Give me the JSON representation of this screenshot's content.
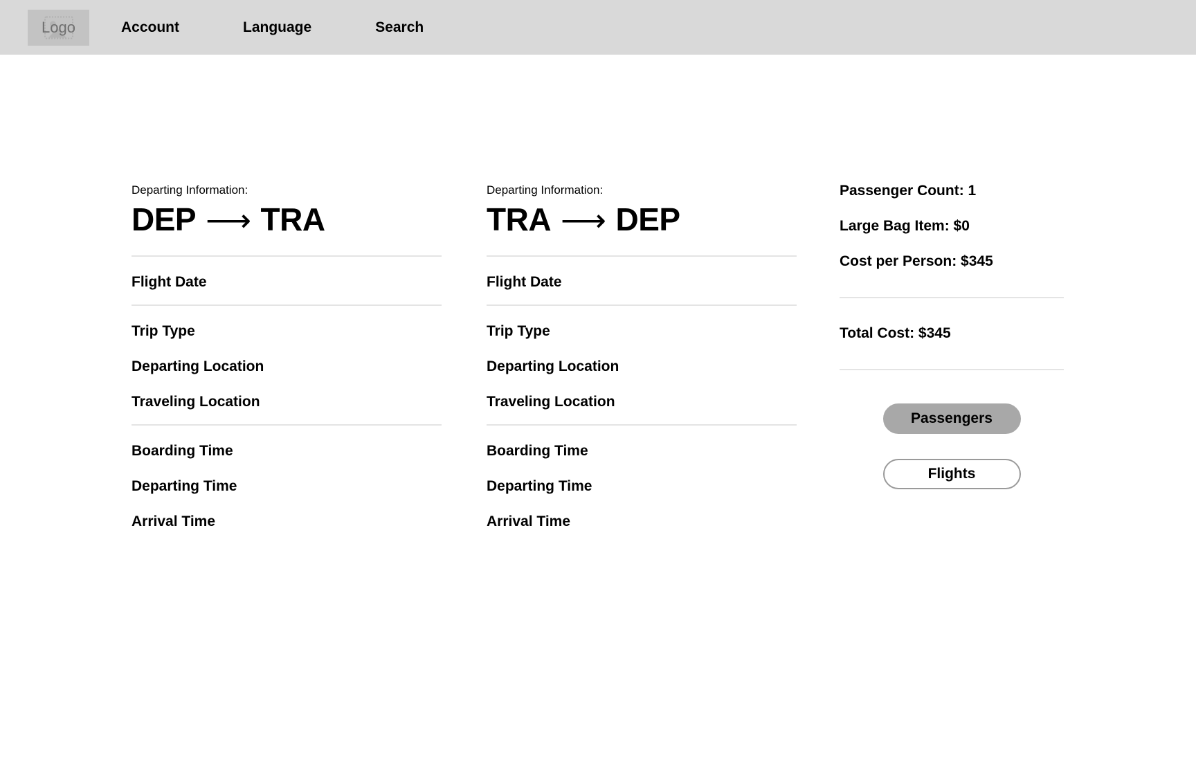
{
  "header": {
    "logo": {
      "text": "Logo",
      "icon": "image-placeholder-icon"
    },
    "nav": [
      {
        "label": "Account"
      },
      {
        "label": "Language"
      },
      {
        "label": "Search"
      }
    ]
  },
  "colors": {
    "header_bg": "#d9d9d9",
    "logo_bg": "#c3c3c3",
    "page_bg": "#ffffff",
    "divider": "#e4e4e4",
    "primary_button_bg": "#a8a8a8",
    "secondary_button_border": "#9a9a9a",
    "text": "#000000"
  },
  "flights": [
    {
      "label": "Departing Information:",
      "origin": "DEP",
      "arrow": "⟶",
      "destination": "TRA",
      "date_group": [
        "Flight Date"
      ],
      "trip_group": [
        "Trip Type",
        "Departing Location",
        "Traveling Location"
      ],
      "time_group": [
        "Boarding Time",
        "Departing Time",
        "Arrival Time"
      ]
    },
    {
      "label": "Departing Information:",
      "origin": "TRA",
      "arrow": "⟶",
      "destination": "DEP",
      "date_group": [
        "Flight Date"
      ],
      "trip_group": [
        "Trip Type",
        "Departing Location",
        "Traveling Location"
      ],
      "time_group": [
        "Boarding Time",
        "Departing Time",
        "Arrival Time"
      ]
    }
  ],
  "summary": {
    "passenger_count": "Passenger Count: 1",
    "large_bag_item": "Large Bag Item: $0",
    "cost_per_person": "Cost per Person: $345",
    "total_cost": "Total Cost: $345",
    "buttons": {
      "passengers": "Passengers",
      "flights": "Flights"
    }
  }
}
